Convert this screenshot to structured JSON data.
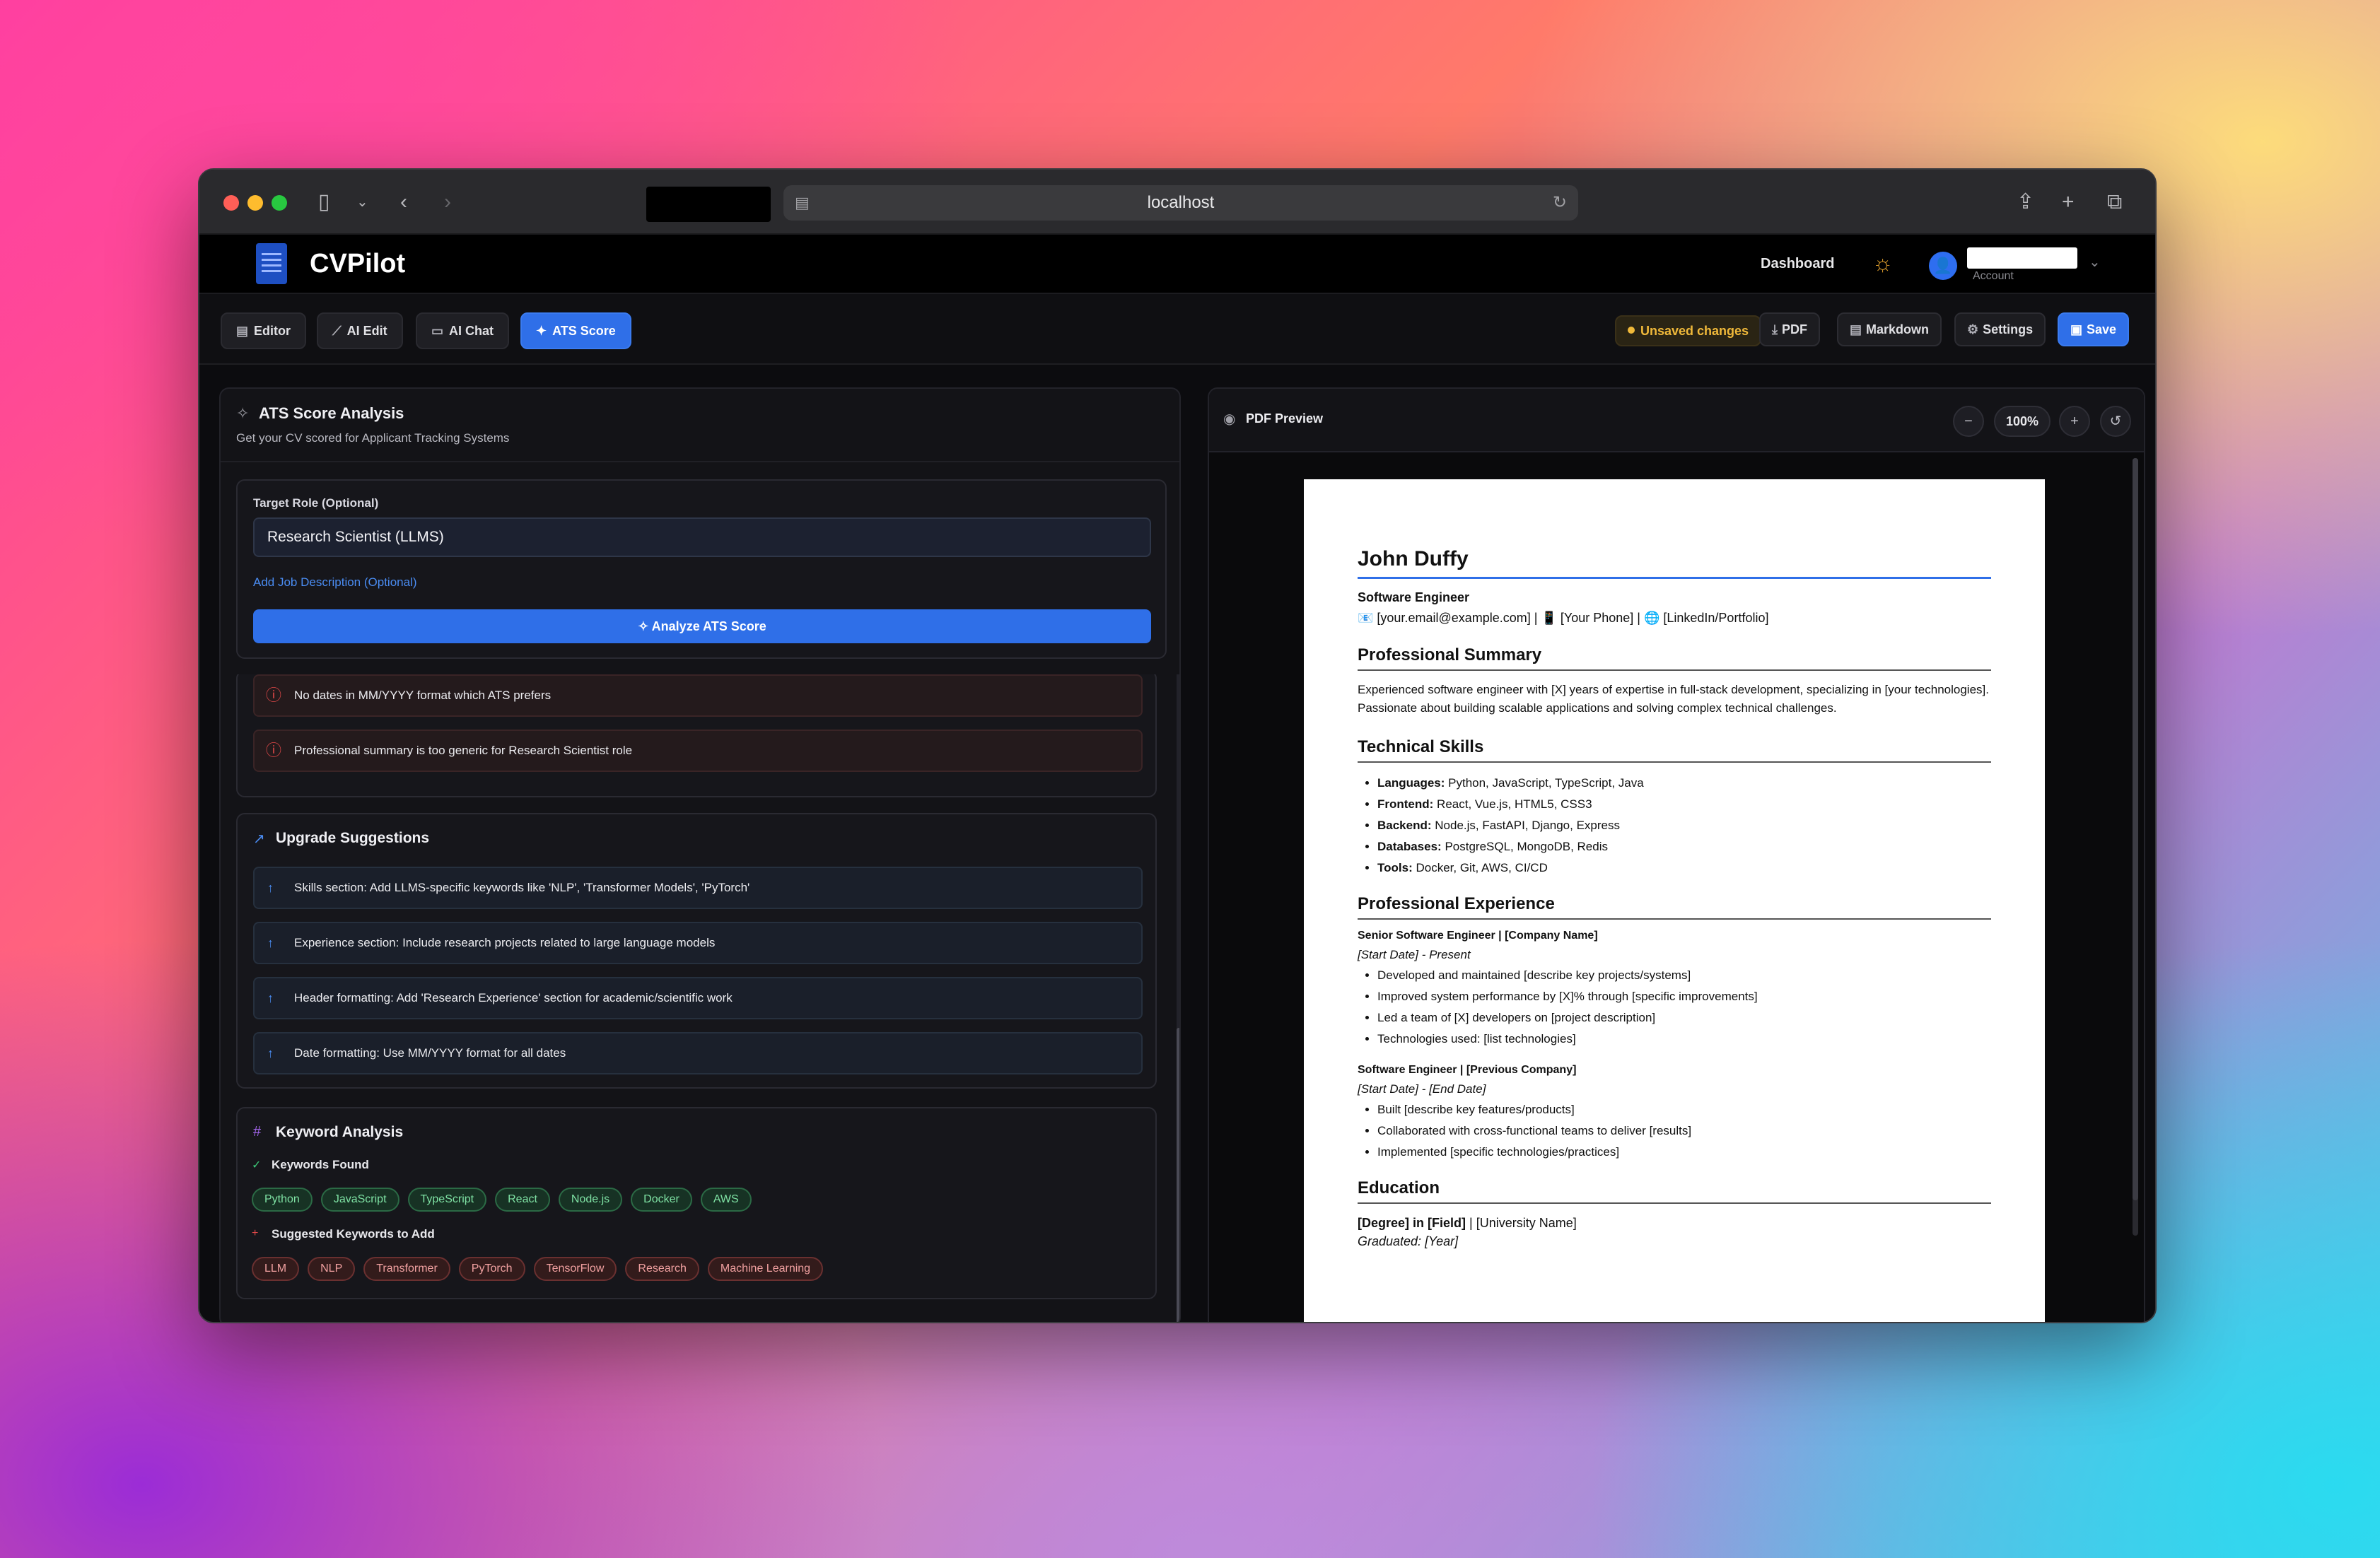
{
  "browser": {
    "url": "localhost"
  },
  "app": {
    "brand": "CVPilot",
    "nav_dashboard": "Dashboard",
    "account_label": "Account"
  },
  "toolbar": {
    "tabs": [
      {
        "label": "Editor",
        "icon": "document-icon"
      },
      {
        "label": "AI Edit",
        "icon": "wand-icon"
      },
      {
        "label": "AI Chat",
        "icon": "chat-icon"
      },
      {
        "label": "ATS Score",
        "icon": "sparkle-icon",
        "active": true
      }
    ],
    "unsaved": "Unsaved changes",
    "pdf": "PDF",
    "markdown": "Markdown",
    "settings": "Settings",
    "save": "Save"
  },
  "ats": {
    "title": "ATS Score Analysis",
    "subtitle": "Get your CV scored for Applicant Tracking Systems",
    "target_label": "Target Role (Optional)",
    "target_value": "Research Scientist (LLMS)",
    "add_jd": "Add Job Description (Optional)",
    "analyze": "Analyze ATS Score",
    "issues": [
      "No dates in MM/YYYY format which ATS prefers",
      "Professional summary is too generic for Research Scientist role"
    ],
    "suggestions_title": "Upgrade Suggestions",
    "suggestions": [
      "Skills section: Add LLMS-specific keywords like 'NLP', 'Transformer Models', 'PyTorch'",
      "Experience section: Include research projects related to large language models",
      "Header formatting: Add 'Research Experience' section for academic/scientific work",
      "Date formatting: Use MM/YYYY format for all dates"
    ],
    "keywords_title": "Keyword Analysis",
    "found_label": "Keywords Found",
    "found": [
      "Python",
      "JavaScript",
      "TypeScript",
      "React",
      "Node.js",
      "Docker",
      "AWS"
    ],
    "suggested_label": "Suggested Keywords to Add",
    "suggested": [
      "LLM",
      "NLP",
      "Transformer",
      "PyTorch",
      "TensorFlow",
      "Research",
      "Machine Learning"
    ]
  },
  "preview": {
    "title": "PDF Preview",
    "zoom": "100%"
  },
  "cv": {
    "name": "John Duffy",
    "role": "Software Engineer",
    "contact": "📧 [your.email@example.com] | 📱 [Your Phone] | 🌐 [LinkedIn/Portfolio]",
    "summary_h": "Professional Summary",
    "summary": "Experienced software engineer with [X] years of expertise in full-stack development, specializing in [your technologies]. Passionate about building scalable applications and solving complex technical challenges.",
    "skills_h": "Technical Skills",
    "skills": [
      {
        "k": "Languages:",
        "v": " Python, JavaScript, TypeScript, Java"
      },
      {
        "k": "Frontend:",
        "v": " React, Vue.js, HTML5, CSS3"
      },
      {
        "k": "Backend:",
        "v": " Node.js, FastAPI, Django, Express"
      },
      {
        "k": "Databases:",
        "v": " PostgreSQL, MongoDB, Redis"
      },
      {
        "k": "Tools:",
        "v": " Docker, Git, AWS, CI/CD"
      }
    ],
    "exp_h": "Professional Experience",
    "job1": "Senior Software Engineer | [Company Name]",
    "job1_date": "[Start Date] - Present",
    "job1_items": [
      "Developed and maintained [describe key projects/systems]",
      "Improved system performance by [X]% through [specific improvements]",
      "Led a team of [X] developers on [project description]",
      "Technologies used: [list technologies]"
    ],
    "job2": "Software Engineer | [Previous Company]",
    "job2_date": "[Start Date] - [End Date]",
    "job2_items": [
      "Built [describe key features/products]",
      "Collaborated with cross-functional teams to deliver [results]",
      "Implemented [specific technologies/practices]"
    ],
    "edu_h": "Education",
    "edu_degree": "[Degree] in [Field]",
    "edu_uni": " | [University Name]",
    "edu_grad": "Graduated: [Year]"
  }
}
